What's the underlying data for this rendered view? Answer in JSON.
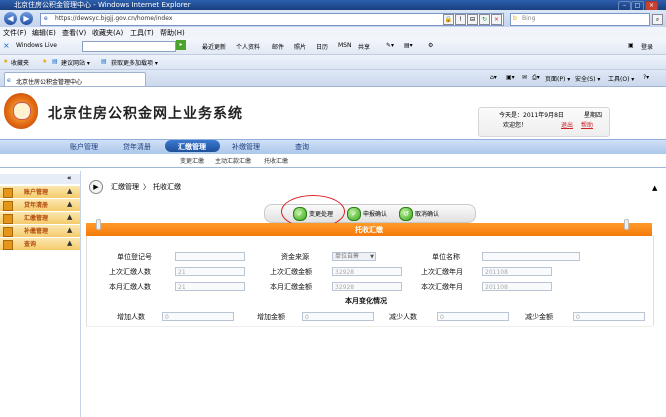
{
  "browser": {
    "title": "北京住房公积金管理中心 - Windows Internet Explorer",
    "url": "https://dewsyc.bjgjj.gov.cn/home/index",
    "search_placeholder": "Bing",
    "menu": [
      "文件(F)",
      "编辑(E)",
      "查看(V)",
      "收藏夹(A)",
      "工具(T)",
      "帮助(H)"
    ],
    "windows_live": "Windows Live",
    "toolbar2": [
      "最近更新",
      "个人资料",
      "邮件",
      "照片",
      "日历",
      "MSN",
      "共享"
    ],
    "signin": "登录",
    "favorites_label": "收藏夹",
    "favorites_items": [
      "建议网站 ▾",
      "获取更多加载项 ▾"
    ],
    "tab_title": "北京住房公积金管理中心",
    "tab_tools": [
      "页面(P) ▾",
      "安全(S) ▾",
      "工具(O) ▾"
    ]
  },
  "header": {
    "site_title": "北京住房公积金网上业务系统",
    "date_text": "今天是：2011年9月8日",
    "weekday": "星期四",
    "welcome": "欢迎您！",
    "logout": "退出",
    "help": "帮助"
  },
  "nav": {
    "items": [
      "账户管理",
      "贷年清册",
      "汇缴管理",
      "补缴管理",
      "查询"
    ],
    "subnav": [
      "变更汇缴",
      "主动汇款汇缴",
      "托收汇缴"
    ]
  },
  "sidebar": {
    "collapse": "«",
    "items": [
      "账户管理",
      "贷年清册",
      "汇缴管理",
      "补缴管理",
      "查询"
    ]
  },
  "breadcrumb": {
    "parent": "汇缴管理",
    "separator": "〉",
    "current": "托收汇缴"
  },
  "actions": {
    "change": "变更处理",
    "apply": "申报确认",
    "cancel": "取消确认"
  },
  "form": {
    "section_title": "托收汇缴",
    "labels": {
      "unit_reg_no": "单位登记号",
      "fund_source": "资金来源",
      "unit_name": "单位名称",
      "last_count": "上次汇缴人数",
      "last_amount": "上次汇缴金额",
      "last_month": "上次汇缴年月",
      "this_count": "本月汇缴人数",
      "this_amount": "本月汇缴金额",
      "this_month": "本次汇缴年月",
      "change_title": "本月变化情况",
      "add_count": "增加人数",
      "add_amount": "增加金额",
      "reduce_count": "减少人数",
      "reduce_amount": "减少金额"
    },
    "values": {
      "fund_source": "单位自筹",
      "last_count": "21",
      "last_amount": "32928",
      "last_month": "201108",
      "this_count": "21",
      "this_amount": "32928",
      "this_month": "201108",
      "add_count": "0",
      "add_amount": "0",
      "reduce_count": "0",
      "reduce_amount": "0"
    }
  },
  "colors": {
    "accent_orange": "#f47a0a",
    "nav_blue": "#1f4f9a",
    "highlight_red": "#dd2222"
  }
}
